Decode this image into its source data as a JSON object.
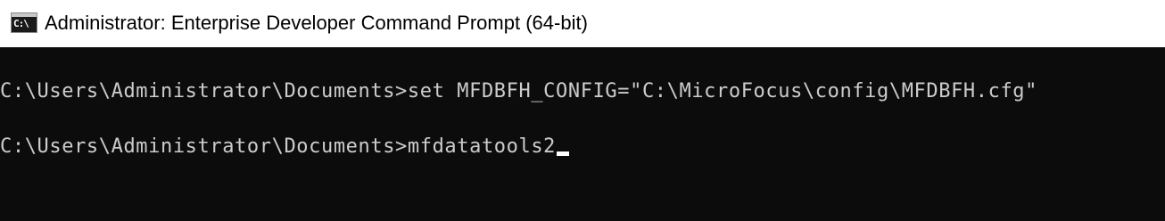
{
  "window": {
    "title": "Administrator: Enterprise Developer Command Prompt (64-bit)",
    "icon": "command-prompt-icon",
    "icon_text": "C:\\",
    "background_color": "#0c0c0c",
    "text_color": "#cccccc"
  },
  "console": {
    "lines": [
      {
        "prompt": "C:\\Users\\Administrator\\Documents>",
        "command": "set MFDBFH_CONFIG=\"C:\\MicroFocus\\config\\MFDBFH.cfg\""
      },
      {
        "prompt": "C:\\Users\\Administrator\\Documents>",
        "command": "mfdatatools2"
      }
    ]
  }
}
